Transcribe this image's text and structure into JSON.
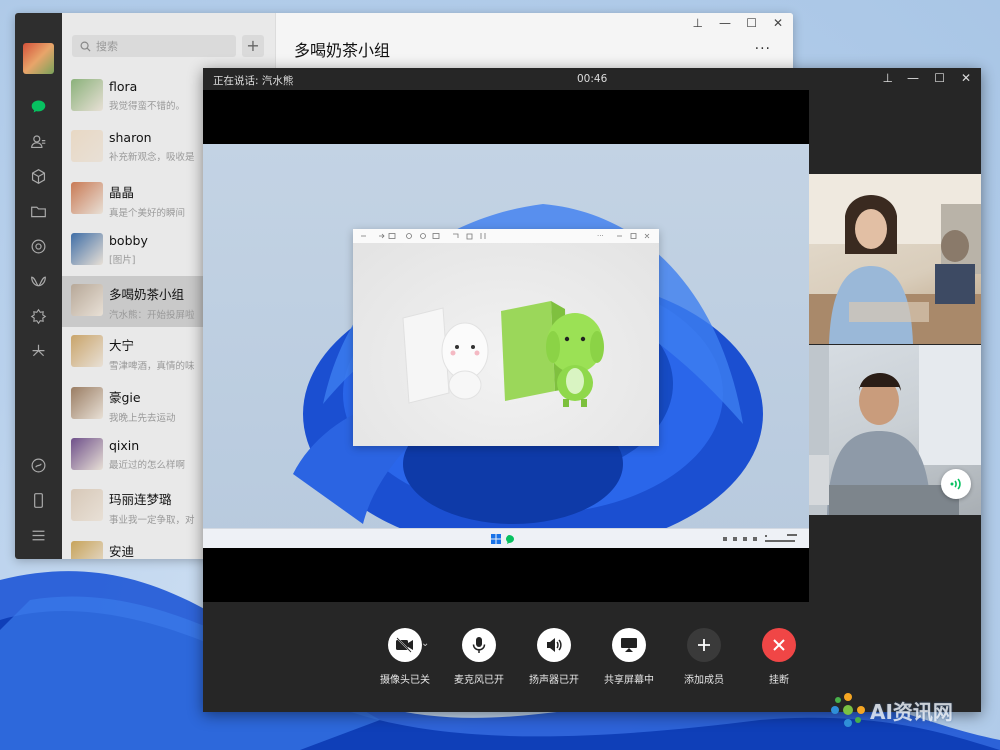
{
  "wechat": {
    "search_placeholder": "搜索",
    "add_label": "+",
    "chats": [
      {
        "name": "flora",
        "msg": "我觉得蛮不错的。",
        "color": "#8ab17a"
      },
      {
        "name": "sharon",
        "msg": "补充新观念，吸收是",
        "color": "#e8d8c4"
      },
      {
        "name": "晶晶",
        "msg": "真是个美好的瞬间",
        "color": "#c97a55"
      },
      {
        "name": "bobby",
        "msg": "[图片]",
        "color": "#3f6ea6"
      },
      {
        "name": "多喝奶茶小组",
        "msg": "汽水熊：开始投屏啦",
        "color": "#b7a898"
      },
      {
        "name": "大宁",
        "msg": "雪津啤酒，真情的味",
        "color": "#c9a46a"
      },
      {
        "name": "豪gie",
        "msg": "我晚上先去运动",
        "color": "#9a7d63"
      },
      {
        "name": "qixin",
        "msg": "最近过的怎么样啊",
        "color": "#6e4f8a"
      },
      {
        "name": "玛丽连梦璐",
        "msg": "事业我一定争取，对",
        "color": "#d7c8b8"
      },
      {
        "name": "安迪",
        "msg": "",
        "color": "#c7a35a"
      }
    ],
    "conversation_title": "多喝奶茶小组",
    "more_label": "···",
    "window_controls": {
      "pin": "⊥",
      "min": "—",
      "max": "☐",
      "close": "✕"
    }
  },
  "call": {
    "speaking": "正在说话: 汽水熊",
    "timer": "00:46",
    "window_controls": {
      "pin": "⊥",
      "min": "—",
      "max": "☐",
      "close": "✕"
    },
    "controls": [
      {
        "label": "摄像头已关",
        "icon": "camera-off-icon",
        "style": "white"
      },
      {
        "label": "麦克风已开",
        "icon": "microphone-icon",
        "style": "white"
      },
      {
        "label": "扬声器已开",
        "icon": "speaker-icon",
        "style": "white"
      },
      {
        "label": "共享屏幕中",
        "icon": "screen-share-icon",
        "style": "white"
      },
      {
        "label": "添加成员",
        "icon": "plus-icon",
        "style": "dark"
      },
      {
        "label": "挂断",
        "icon": "hang-up-icon",
        "style": "red"
      }
    ],
    "colors": {
      "hangup": "#f04646",
      "speaking_indicator": "#07c160"
    }
  },
  "watermark": {
    "text": "AI资讯网"
  }
}
